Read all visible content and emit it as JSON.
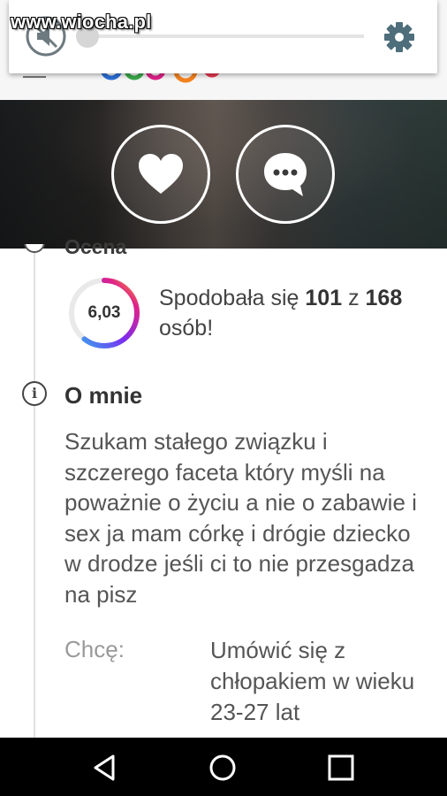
{
  "watermark": "www.wiocha.pl",
  "volume_overlay": {
    "level": 0
  },
  "profile": {
    "actions": [
      {
        "icon": "heart-icon"
      },
      {
        "icon": "chat-bubble-icon"
      }
    ]
  },
  "rating": {
    "section_title": "Ocena",
    "score": "6,03",
    "score_fraction": 0.603,
    "ring_colors": [
      "#f5a623",
      "#e0218a",
      "#7b2cf0",
      "#2fb8ee"
    ],
    "text_prefix": "Spodobała się ",
    "likes": "101",
    "text_middle": " z ",
    "total": "168",
    "text_suffix": " osób!"
  },
  "about": {
    "title": "O mnie",
    "text": "Szukam stałego związku i szczerego faceta który myśli na poważnie o życiu a nie o zabawie i sex ja mam córkę i drógie dziecko w drodze jeśli ci to nie przesgadza na pisz",
    "wants_label": "Chcę:",
    "wants_value": "Umówić się  z chłopakiem w wieku 23-27 lat"
  },
  "nav_bar": {
    "buttons": [
      "back-icon",
      "home-icon",
      "recents-icon"
    ]
  }
}
